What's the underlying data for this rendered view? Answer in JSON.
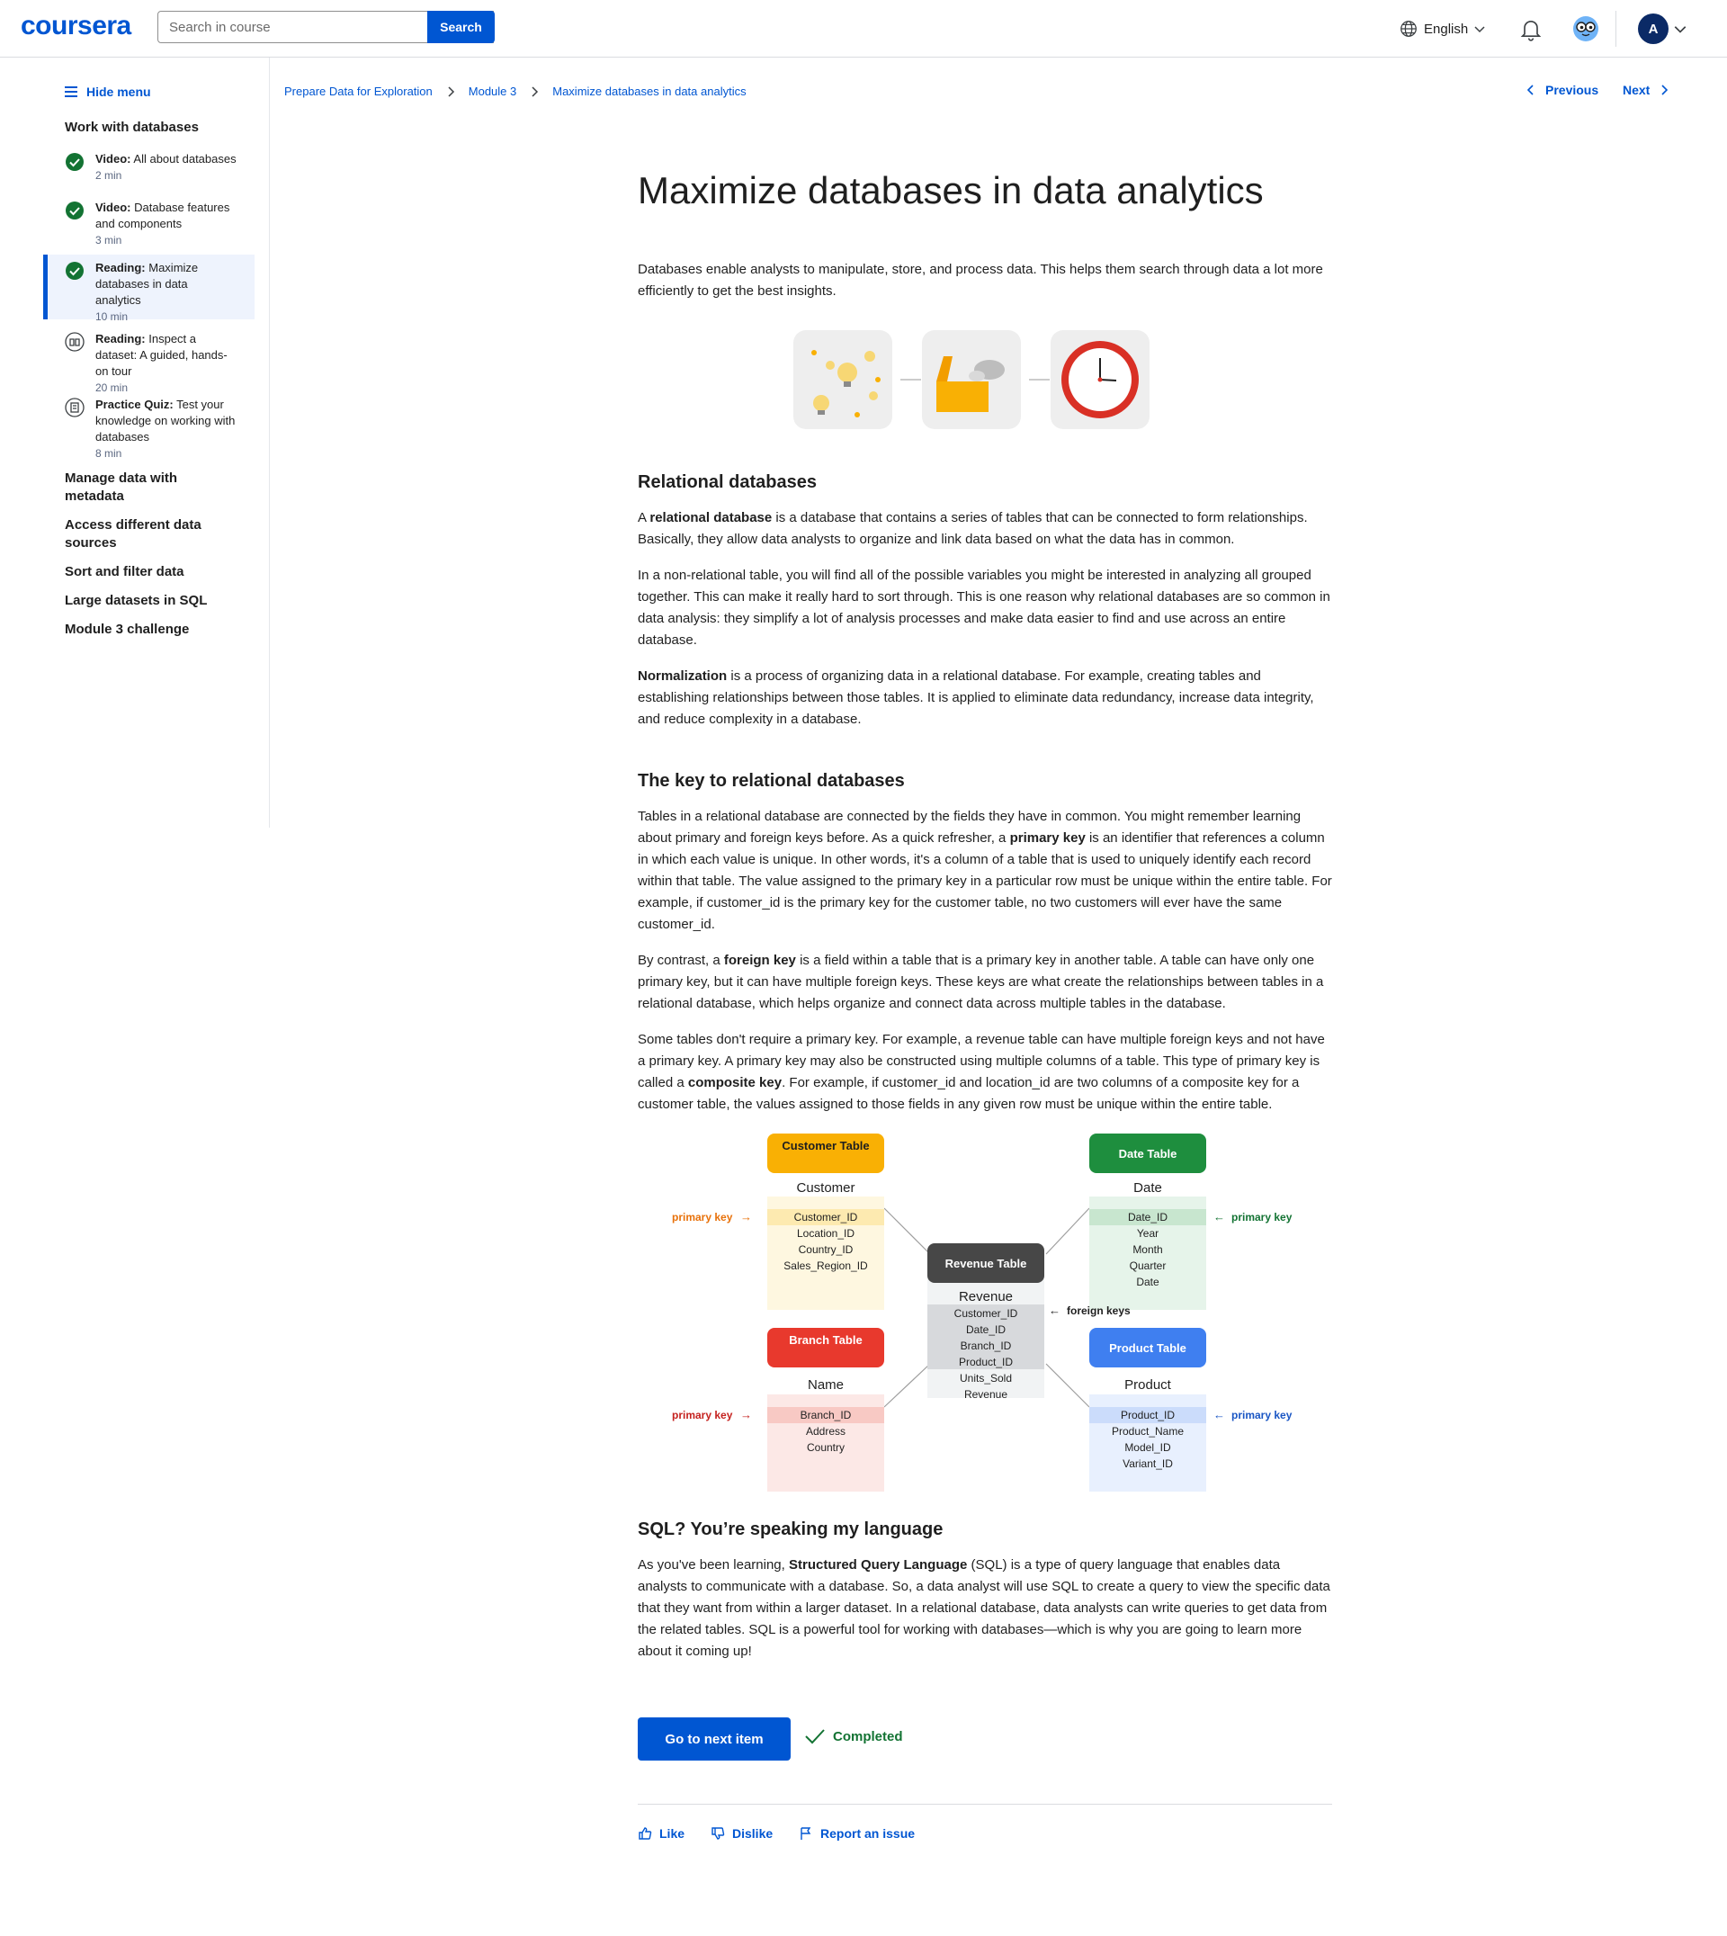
{
  "header": {
    "logo": "coursera",
    "search_placeholder": "Search in course",
    "search_button": "Search",
    "language": "English",
    "avatar_initial": "A"
  },
  "sidebar": {
    "hide_menu": "Hide menu",
    "section_current": "Work with databases",
    "items": [
      {
        "type": "Video:",
        "title": "All about databases",
        "duration": "2 min",
        "status": "completed"
      },
      {
        "type": "Video:",
        "title": "Database features and components",
        "duration": "3 min",
        "status": "completed"
      },
      {
        "type": "Reading:",
        "title": "Maximize databases in data analytics",
        "duration": "10 min",
        "status": "completed"
      },
      {
        "type": "Reading:",
        "title": "Inspect a dataset: A guided, hands-on tour",
        "duration": "20 min",
        "status": "pending"
      },
      {
        "type": "Practice Quiz:",
        "title": "Test your knowledge on working with databases",
        "duration": "8 min",
        "status": "pending"
      }
    ],
    "other_sections": [
      "Manage data with metadata",
      "Access different data sources",
      "Sort and filter data",
      "Large datasets in SQL",
      "Module 3 challenge"
    ]
  },
  "breadcrumb": [
    "Prepare Data for Exploration",
    "Module 3",
    "Maximize databases in data analytics"
  ],
  "nav": {
    "previous": "Previous",
    "next": "Next"
  },
  "article": {
    "title": "Maximize databases in data analytics",
    "intro": "Databases enable analysts to manipulate, store, and process data. This helps them search through data a lot more efficiently to get the best insights.",
    "h_relational": "Relational databases",
    "p1_pre": "A ",
    "p1_bold": "relational database",
    "p1_post": " is a database that contains a series of tables that can be connected to form relationships. Basically, they allow data analysts to organize and link data based on what the data has in common.",
    "p2": "In a non-relational table, you will find all of the possible variables you might be interested in analyzing all grouped together. This can make it really hard to sort through. This is one reason why relational databases are so common in data analysis: they simplify a lot of analysis processes and make data easier to find and use across an entire database.",
    "p3_bold": "Normalization",
    "p3_post": " is a process of organizing data in a relational database. For example, creating tables and establishing relationships between those tables. It is applied to eliminate data redundancy, increase data integrity, and reduce complexity in a database.",
    "h_key": "The key to relational databases",
    "p4_pre": "Tables in a relational database are connected by the fields they have in common. You might remember learning about primary and foreign keys before. As a quick refresher, a ",
    "p4_bold": "primary key",
    "p4_post": " is an identifier that references a column in which each value is unique. In other words, it's a column of a table that is used to uniquely identify each record within that table. The value assigned to the primary key in a particular row must be unique within the entire table. For example, if customer_id is the primary key for the customer table, no two customers will ever have the same customer_id.",
    "p5_pre": "By contrast, a ",
    "p5_bold": "foreign key",
    "p5_post": " is a field within a table that is a primary key in another table. A table can have only one primary key, but it can have multiple foreign keys. These keys are what create the relationships between tables in a relational database, which helps organize and connect data across multiple tables in the database.",
    "p6_pre": "Some tables don't require a primary key. For example, a revenue table can have multiple foreign keys and not have a primary key. A primary key may also be constructed using multiple columns of a table. This type of primary key is called a ",
    "p6_bold": "composite key",
    "p6_post": ". For example, if customer_id and location_id are two columns of a composite key for a customer table, the values assigned to those fields in any given row must be unique within the entire table.",
    "h_sql": "SQL? You’re speaking my language",
    "p7_pre": "As you've been learning, ",
    "p7_bold": "Structured Query Language",
    "p7_post": " (SQL) is a type of query language that enables data analysts to communicate with a database. So, a data analyst will use SQL to create a query to view the specific data that they want from within a larger dataset. In a relational database, data analysts can write queries to get data from the related tables. SQL is a powerful tool for working with databases—which is why you are going to learn more about it coming up!"
  },
  "diagram": {
    "customer": {
      "header": "Customer Table",
      "name": "Customer",
      "fields": [
        "Customer_ID",
        "Location_ID",
        "Country_ID",
        "Sales_Region_ID"
      ],
      "color": "#f9b004"
    },
    "date": {
      "header": "Date Table",
      "name": "Date",
      "fields": [
        "Date_ID",
        "Year",
        "Month",
        "Quarter",
        "Date"
      ],
      "color": "#1e8e3e"
    },
    "revenue": {
      "header": "Revenue Table",
      "name": "Revenue",
      "fields": [
        "Customer_ID",
        "Date_ID",
        "Branch_ID",
        "Product_ID",
        "Units_Sold",
        "Revenue"
      ],
      "color": "#474747"
    },
    "branch": {
      "header": "Branch Table",
      "name": "Name",
      "fields": [
        "Branch_ID",
        "Address",
        "Country"
      ],
      "color": "#e8392d"
    },
    "product": {
      "header": "Product Table",
      "name": "Product",
      "fields": [
        "Product_ID",
        "Product_Name",
        "Model_ID",
        "Variant_ID"
      ],
      "color": "#3f7ff0"
    },
    "label_primary": "primary key",
    "label_foreign": "foreign keys"
  },
  "actions": {
    "next_item": "Go to next item",
    "completed": "Completed",
    "like": "Like",
    "dislike": "Dislike",
    "report": "Report an issue"
  }
}
